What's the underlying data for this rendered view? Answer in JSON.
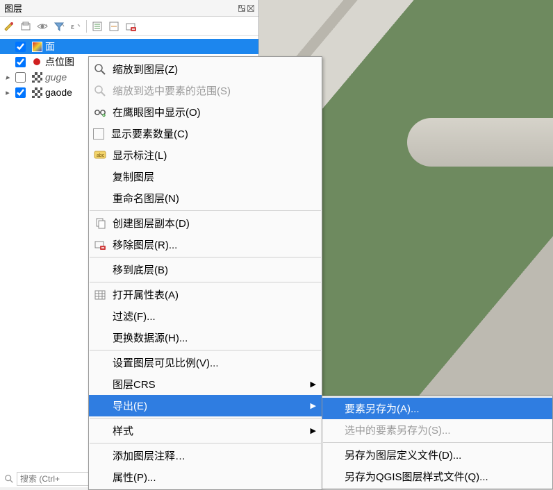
{
  "panel": {
    "title": "图层",
    "search_placeholder": "搜索 (Ctrl+"
  },
  "layers": [
    {
      "name": "面",
      "checked": true,
      "selected": true,
      "sym": "poly",
      "expand": ""
    },
    {
      "name": "点位图",
      "checked": true,
      "selected": false,
      "sym": "point",
      "expand": ""
    },
    {
      "name": "guge",
      "checked": false,
      "selected": false,
      "sym": "raster",
      "expand": "▸",
      "italic": true
    },
    {
      "name": "gaode",
      "checked": true,
      "selected": false,
      "sym": "raster",
      "expand": "▸"
    }
  ],
  "ctx": {
    "zoom_to_layer": "缩放到图层(Z)",
    "zoom_to_selection": "缩放到选中要素的范围(S)",
    "show_in_overview": "在鹰眼图中显示(O)",
    "show_feature_count": "显示要素数量(C)",
    "show_labels": "显示标注(L)",
    "copy_layer": "复制图层",
    "rename_layer": "重命名图层(N)",
    "duplicate_layer": "创建图层副本(D)",
    "remove_layer": "移除图层(R)...",
    "move_to_bottom": "移到底层(B)",
    "open_attr_table": "打开属性表(A)",
    "filter": "过滤(F)...",
    "change_data_source": "更换数据源(H)...",
    "set_scale_visibility": "设置图层可见比例(V)...",
    "layer_crs": "图层CRS",
    "export": "导出(E)",
    "styles": "样式",
    "add_layer_notes": "添加图层注释…",
    "properties": "属性(P)..."
  },
  "submenu": {
    "save_features_as": "要素另存为(A)...",
    "save_selected_features_as": "选中的要素另存为(S)...",
    "save_as_layer_definition": "另存为图层定义文件(D)...",
    "save_as_qgis_style": "另存为QGIS图层样式文件(Q)..."
  }
}
